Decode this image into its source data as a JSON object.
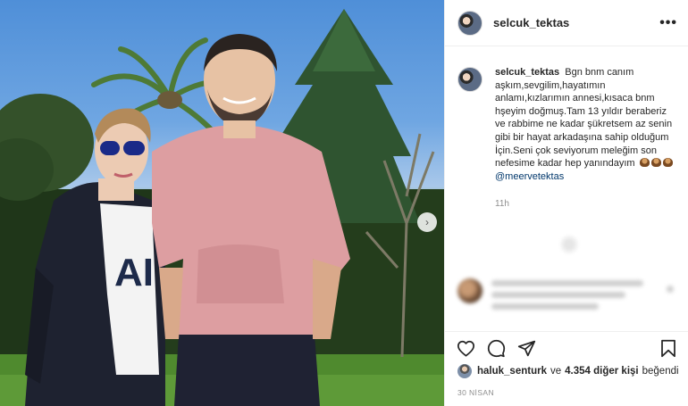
{
  "post": {
    "username": "selcuk_tektas",
    "more_label": "•••"
  },
  "caption": {
    "username": "selcuk_tektas",
    "text": "Bgn bnm canım aşkım,sevgilim,hayatımın anlamı,kızlarımın annesi,kısaca bnm hşeyim doğmuş.Tam 13 yıldır beraberiz ve rabbime ne kadar şükretsem az senin gibi bir hayat arkadaşına sahip olduğum İçin.Seni çok seviyorum meleğim son nefesime kadar hep yanındayım",
    "emoji_name": "pie-emoji",
    "mention": "@meervetektas",
    "time_ago": "11h"
  },
  "likes": {
    "first_liker": "haluk_senturk",
    "connector": "ve",
    "others": "4.354 diğer kişi",
    "suffix": "beğendi"
  },
  "post_date": "30 NİSAN",
  "carousel": {
    "next_glyph": "›"
  },
  "icons": [
    "heart-icon",
    "comment-icon",
    "share-icon",
    "bookmark-icon",
    "more-options-icon",
    "chevron-right-icon"
  ],
  "colors": {
    "text": "#262626",
    "secondary": "#8e8e8e",
    "mention": "#00376b",
    "border": "#efefef"
  }
}
